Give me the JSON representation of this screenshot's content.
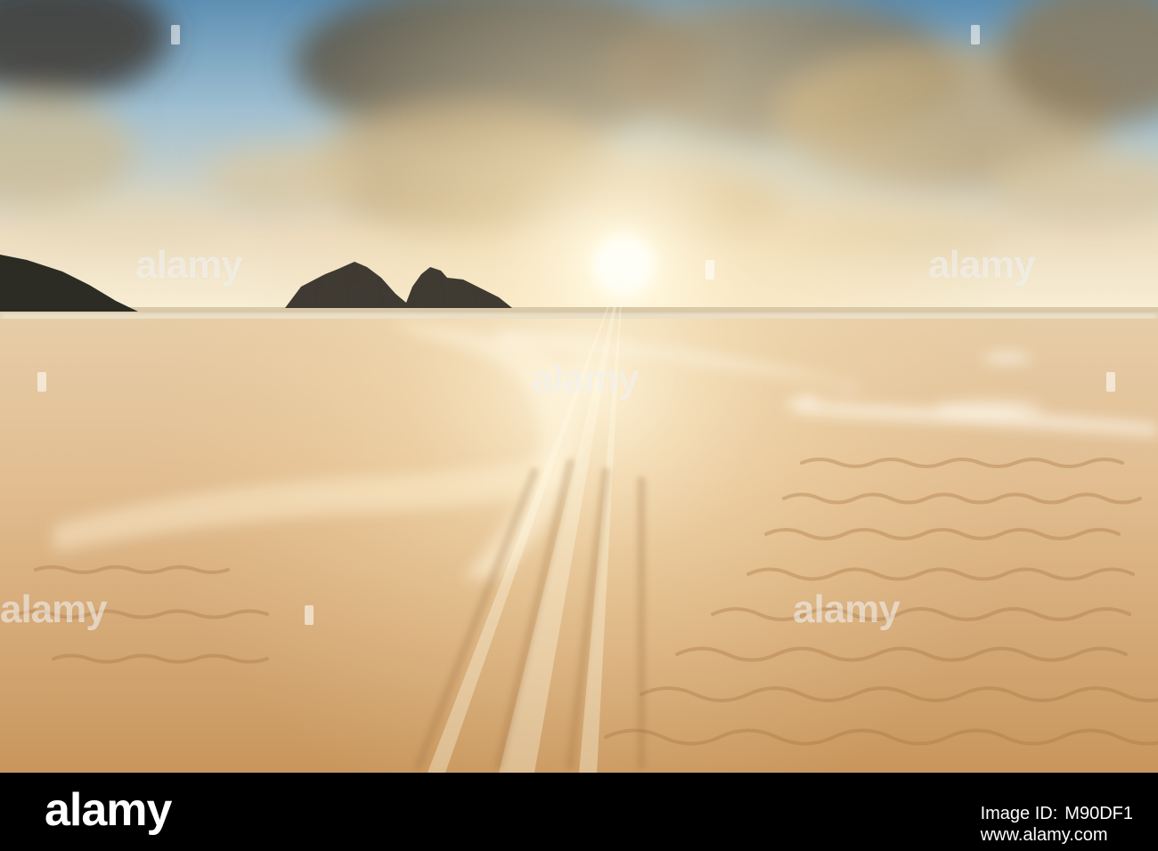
{
  "watermark": {
    "text": "alamy",
    "color": "#ffffff"
  },
  "footer": {
    "brand": "alamy",
    "image_id_label": "Image ID:",
    "image_id": "M90DF1",
    "url": "www.alamy.com",
    "background": "#000000"
  },
  "scene": {
    "subject": "sunset over sandy beach with sea stacks",
    "colors": {
      "sky_top": "#6f9dbb",
      "sky_horizon": "#f6ecd0",
      "sun": "#fffdf2",
      "sand_light": "#e8c69a",
      "sand_dark": "#c99a62",
      "rocks": "#2e2a24"
    }
  }
}
